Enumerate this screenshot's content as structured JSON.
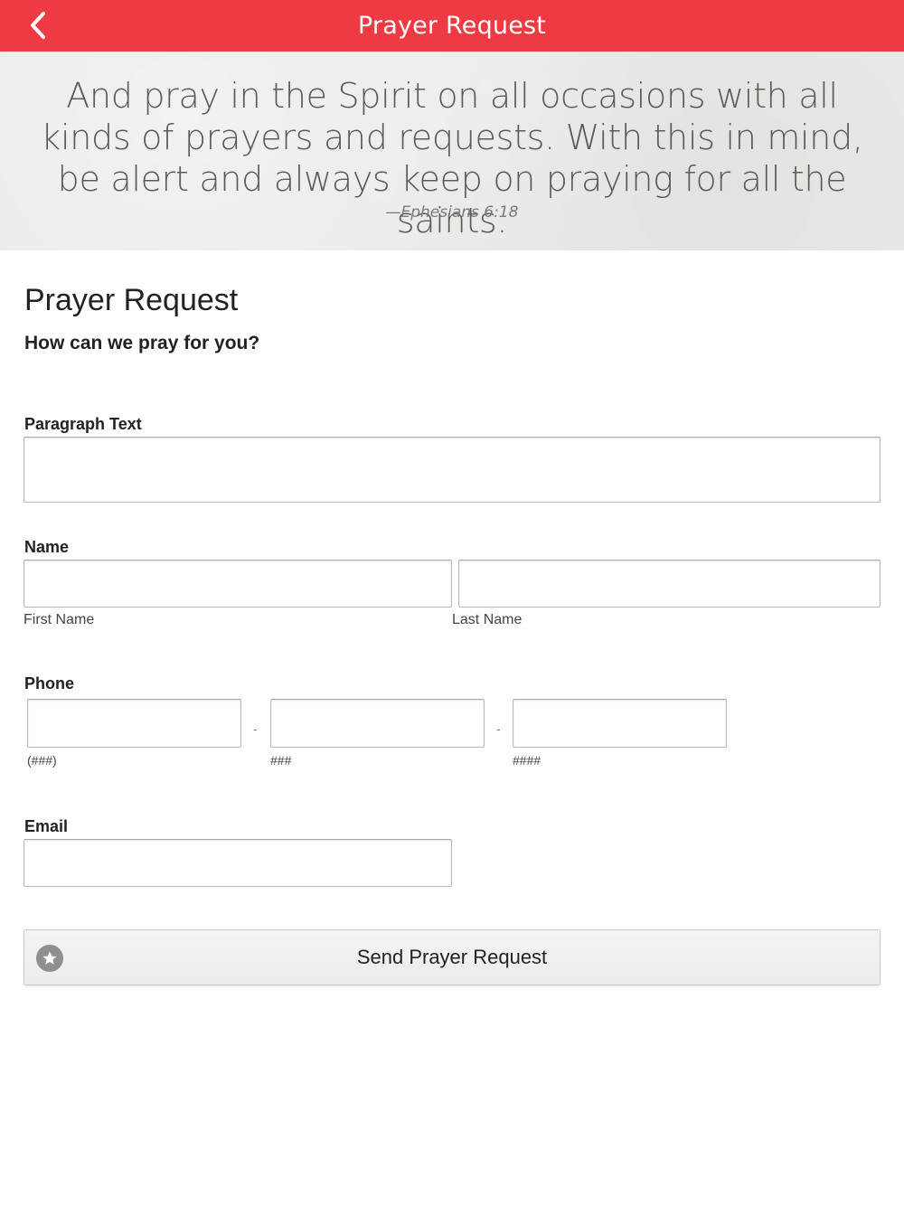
{
  "header": {
    "title": "Prayer Request",
    "back_icon": "chevron-left-icon",
    "color": "#ee3a43"
  },
  "banner": {
    "verse": "And pray in the Spirit on all occasions with all kinds of prayers and requests. With this in mind, be alert and always keep on praying for all the saints.",
    "reference": "—Ephesians 6:18"
  },
  "form": {
    "title": "Prayer Request",
    "subtitle": "How can we pray for you?",
    "paragraph": {
      "label": "Paragraph Text",
      "value": ""
    },
    "name": {
      "label": "Name",
      "first": {
        "sublabel": "First Name",
        "value": ""
      },
      "last": {
        "sublabel": "Last Name",
        "value": ""
      }
    },
    "phone": {
      "label": "Phone",
      "area": {
        "sublabel": "(###)",
        "value": ""
      },
      "prefix": {
        "sublabel": "###",
        "value": ""
      },
      "line": {
        "sublabel": "####",
        "value": ""
      },
      "separator": "-"
    },
    "email": {
      "label": "Email",
      "value": ""
    },
    "submit": {
      "label": "Send Prayer Request",
      "icon": "star-icon"
    }
  }
}
